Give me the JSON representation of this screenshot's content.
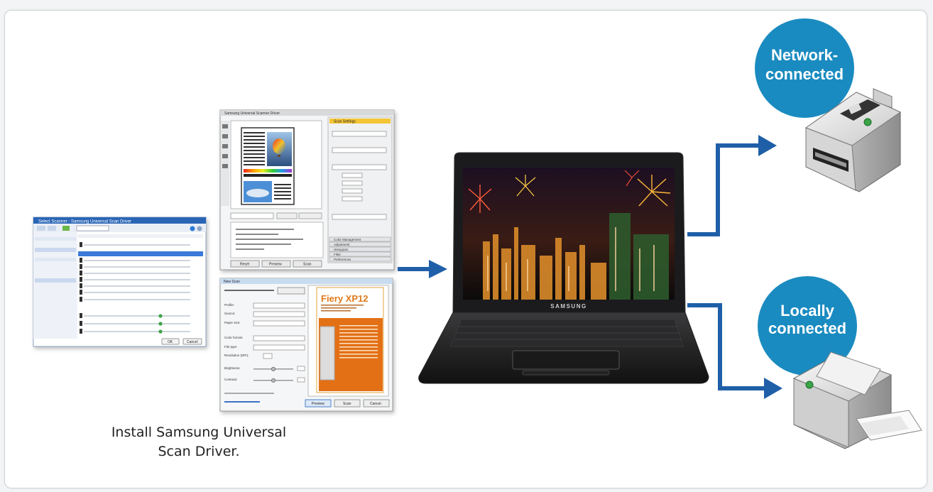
{
  "caption": {
    "line1": "Install Samsung Universal",
    "line2": "Scan Driver."
  },
  "badges": {
    "network": {
      "line1": "Network-",
      "line2": "connected"
    },
    "local": {
      "line1": "Locally",
      "line2": "connected"
    }
  },
  "laptop": {
    "brand": "SAMSUNG"
  },
  "scan_driver_window": {
    "title": "Samsung Universal Scanner Driver",
    "buttons": [
      "Reset",
      "Preview",
      "Scan"
    ],
    "sections": [
      "Scan Settings",
      "Color Management",
      "Adjustment",
      "Histogram",
      "Filter",
      "Preferences"
    ]
  },
  "select_scanner_window": {
    "title": "Select Scanner - Samsung Universal Scan Driver",
    "buttons": [
      "OK",
      "Cancel"
    ]
  },
  "new_scan_window": {
    "title": "New Scan",
    "fields": [
      "Profile:",
      "Source:",
      "Paper size:",
      "Color format:",
      "File type:",
      "Resolution (DPI):",
      "Brightness:",
      "Contrast:"
    ],
    "buttons": [
      "Preview",
      "Scan",
      "Cancel"
    ],
    "preview_title": "Fiery XP12"
  },
  "colors": {
    "accent_blue": "#1f5fa8",
    "badge_blue": "#1a8bc0"
  }
}
